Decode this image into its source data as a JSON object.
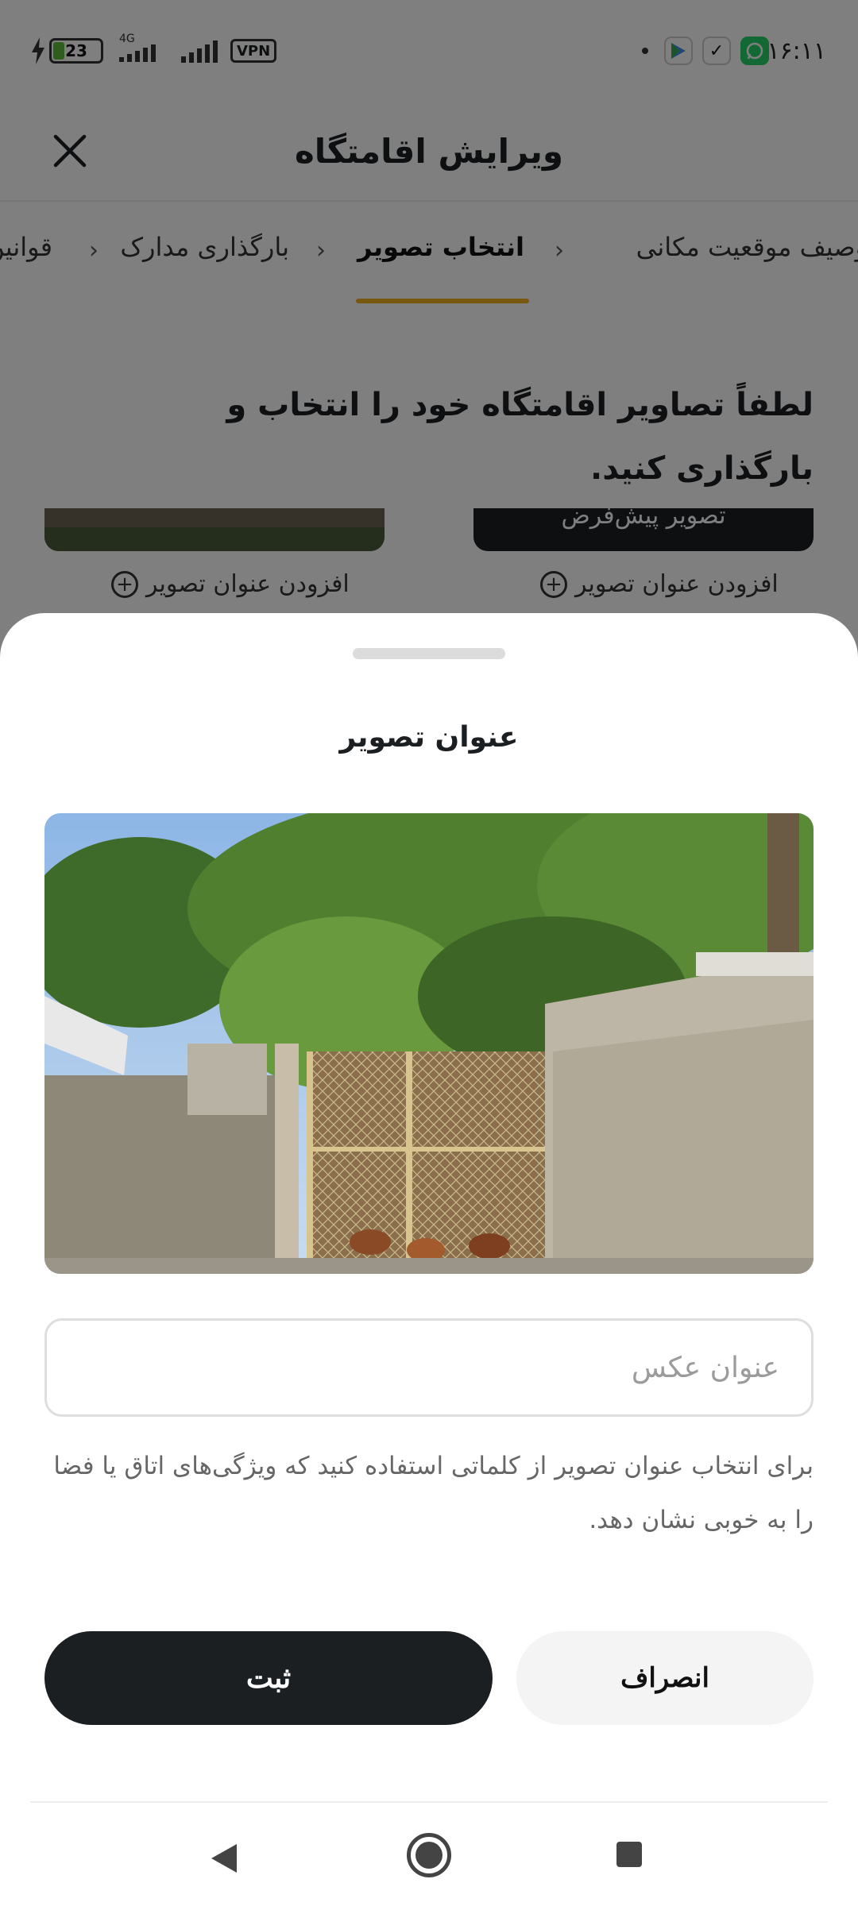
{
  "status_bar": {
    "time": "۱۶:۱۱",
    "battery_level": "23",
    "network": "4G",
    "vpn_label": "VPN"
  },
  "header": {
    "title": "ویرایش اقامتگاه"
  },
  "steps": {
    "items": [
      {
        "label": "توصیف موقعیت مکانی"
      },
      {
        "label": "انتخاب تصویر"
      },
      {
        "label": "بارگذاری مدارک"
      },
      {
        "label": "قوانین"
      }
    ],
    "active_index": 1
  },
  "page": {
    "instruction": "لطفاً تصاویر اقامتگاه خود را انتخاب و بارگذاری کنید.",
    "default_image_label": "تصویر پیش‌فرض",
    "add_caption_label": "افزودن عنوان تصویر"
  },
  "sheet": {
    "title": "عنوان تصویر",
    "input_placeholder": "عنوان عکس",
    "input_value": "",
    "hint": "برای انتخاب عنوان تصویر از کلماتی استفاده کنید که ویژگی‌های اتاق یا فضا را به خوبی نشان دهد.",
    "submit_label": "ثبت",
    "cancel_label": "انصراف"
  },
  "colors": {
    "accent": "#f1b01f",
    "primary_dark": "#1b1f22",
    "scrim": "#000000"
  }
}
